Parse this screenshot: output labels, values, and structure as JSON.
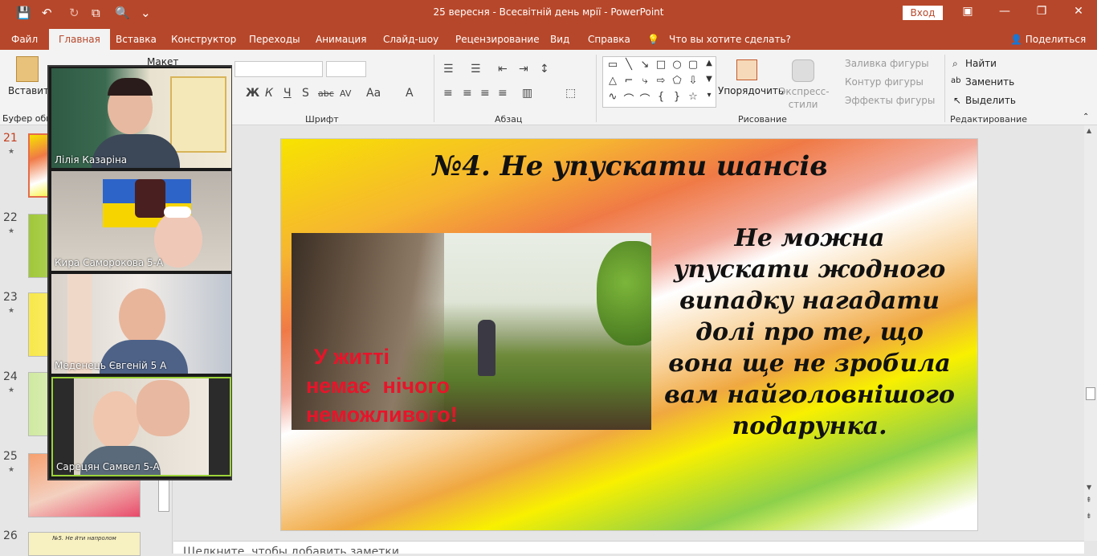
{
  "window": {
    "title": "25 вересня - Всесвітній день мрії  -  PowerPoint",
    "signin_label": "Вход",
    "minimize": "—",
    "restore": "❐",
    "close": "✕",
    "ribbon_display": "▣"
  },
  "qat": {
    "save": "💾",
    "undo": "↶",
    "redo": "↻",
    "present": "⧉",
    "preview": "🔍",
    "more": "⌄"
  },
  "tabs": [
    "Файл",
    "Главная",
    "Вставка",
    "Конструктор",
    "Переходы",
    "Анимация",
    "Слайд-шоу",
    "Рецензирование",
    "Вид",
    "Справка"
  ],
  "active_tab": "Главная",
  "tell_me": "Что вы хотите сделать?",
  "share": "Поделиться",
  "ribbon": {
    "paste_label": "Вставить",
    "layout_label": "Макет",
    "clipboard_group": "Буфер обм",
    "font_group": "Шрифт",
    "paragraph_group": "Абзац",
    "drawing_group": "Рисование",
    "editing_group": "Редактирование",
    "arrange_label": "Упорядочить",
    "quick_styles_label": "Экспресс-стили",
    "shape_fill": "Заливка фигуры",
    "shape_outline": "Контур фигуры",
    "shape_effects": "Эффекты фигуры",
    "find": "Найти",
    "replace": "Заменить",
    "select": "Выделить",
    "font_buttons": [
      "Ж",
      "К",
      "Ч",
      "S",
      "abc",
      "AV",
      "Aa",
      "A"
    ]
  },
  "thumbnails": [
    {
      "num": "21",
      "selected": true
    },
    {
      "num": "22",
      "selected": false
    },
    {
      "num": "23",
      "selected": false
    },
    {
      "num": "24",
      "selected": false
    },
    {
      "num": "25",
      "selected": false
    },
    {
      "num": "26",
      "selected": false
    }
  ],
  "thumb_26_title": "№5. Не йти напролом",
  "slide": {
    "title": "№4. Не упускати шансів",
    "body_lines": [
      "Не можна",
      "упускати жодного",
      "випадку нагадати",
      "долі про те, що",
      "вона ще не зробила",
      "вам найголовнішого",
      "подарунка."
    ],
    "photo_caption_lines": [
      "У житті",
      "немає  нічого",
      "неможливого!"
    ]
  },
  "notes_placeholder": "Щелкните, чтобы добавить заметки",
  "participants": [
    {
      "name": "Лілія Казаріна"
    },
    {
      "name": "Кира Саморокова 5-А"
    },
    {
      "name": "Меденець Євгеній 5 А"
    },
    {
      "name": "Сарецян Самвел 5-А"
    }
  ],
  "colors": {
    "accent": "#b7472a",
    "caption_red": "#e8142a",
    "active_speaker": "#9bd23a"
  }
}
